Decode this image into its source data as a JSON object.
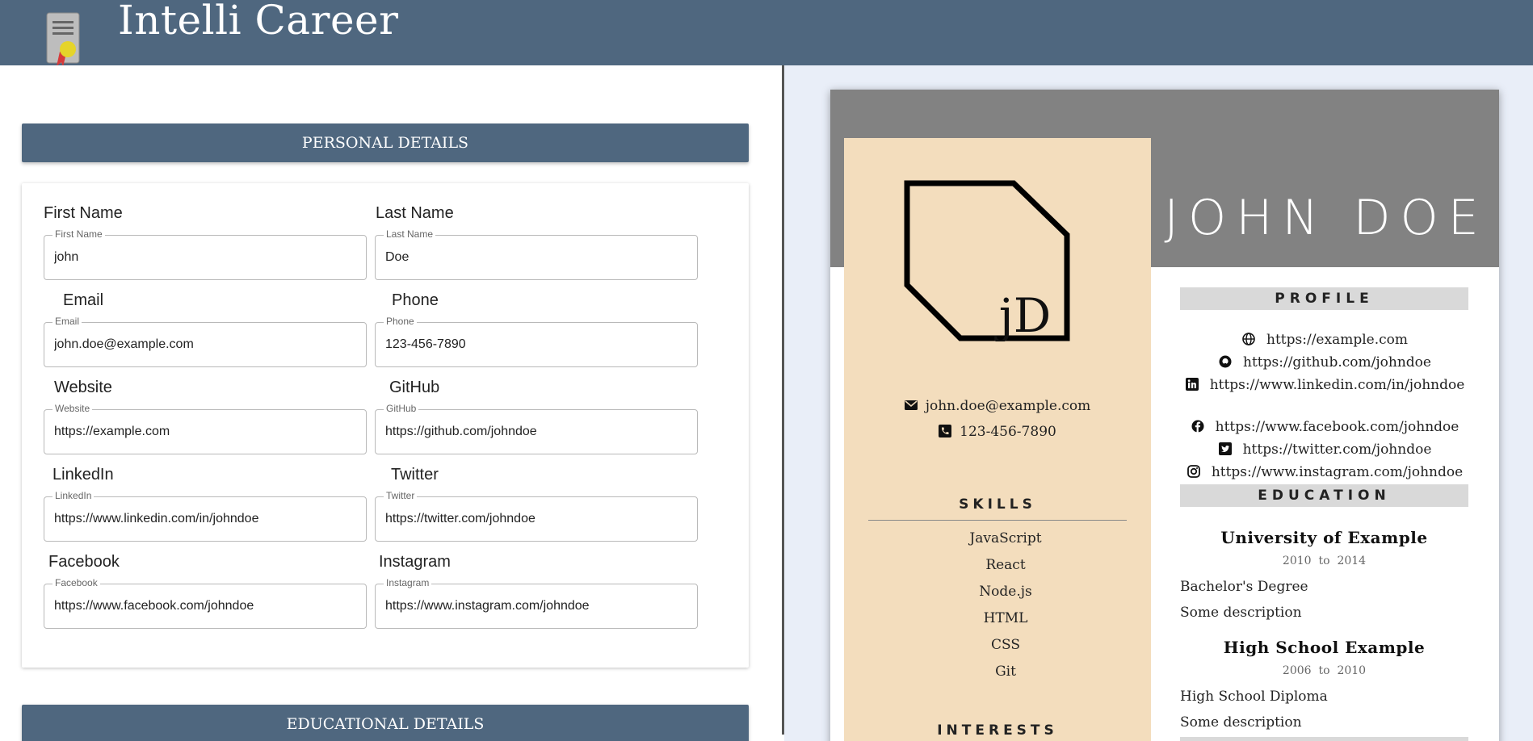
{
  "app": {
    "title": "Intelli Career",
    "logo_icon": "certificate-icon"
  },
  "sections": {
    "personal": "PERSONAL DETAILS",
    "education": "EDUCATIONAL DETAILS"
  },
  "form": {
    "first_name": {
      "label": "First Name",
      "legend": "First Name",
      "value": "john"
    },
    "last_name": {
      "label": "Last Name",
      "legend": "Last Name",
      "value": "Doe"
    },
    "email": {
      "label": "Email",
      "legend": "Email",
      "value": "john.doe@example.com"
    },
    "phone": {
      "label": "Phone",
      "legend": "Phone",
      "value": "123-456-7890"
    },
    "website": {
      "label": "Website",
      "legend": "Website",
      "value": "https://example.com"
    },
    "github": {
      "label": "GitHub",
      "legend": "GitHub",
      "value": "https://github.com/johndoe"
    },
    "linkedin": {
      "label": "LinkedIn",
      "legend": "LinkedIn",
      "value": "https://www.linkedin.com/in/johndoe"
    },
    "twitter": {
      "label": "Twitter",
      "legend": "Twitter",
      "value": "https://twitter.com/johndoe"
    },
    "facebook": {
      "label": "Facebook",
      "legend": "Facebook",
      "value": "https://www.facebook.com/johndoe"
    },
    "instagram": {
      "label": "Instagram",
      "legend": "Instagram",
      "value": "https://www.instagram.com/johndoe"
    }
  },
  "resume": {
    "name": "JOHN DOE",
    "monogram": "jD",
    "email": "john.doe@example.com",
    "phone": "123-456-7890",
    "skills_heading": "SKILLS",
    "skills": [
      "JavaScript",
      "React",
      "Node.js",
      "HTML",
      "CSS",
      "Git"
    ],
    "interests_heading": "INTERESTS",
    "profile_heading": "PROFILE",
    "links": {
      "website": "https://example.com",
      "github": "https://github.com/johndoe",
      "linkedin": "https://www.linkedin.com/in/johndoe",
      "facebook": "https://www.facebook.com/johndoe",
      "twitter": "https://twitter.com/johndoe",
      "instagram": "https://www.instagram.com/johndoe"
    },
    "education_heading": "EDUCATION",
    "education": [
      {
        "school": "University of Example",
        "start": "2010",
        "sep": "to",
        "end": "2014",
        "degree": "Bachelor's Degree",
        "description": "Some description"
      },
      {
        "school": "High School Example",
        "start": "2006",
        "sep": "to",
        "end": "2010",
        "degree": "High School Diploma",
        "description": "Some description"
      }
    ]
  },
  "colors": {
    "header": "#4f677f",
    "resume_band": "#828282",
    "resume_sidebar": "#f3ddbd",
    "preview_bg": "#e9eef8"
  }
}
